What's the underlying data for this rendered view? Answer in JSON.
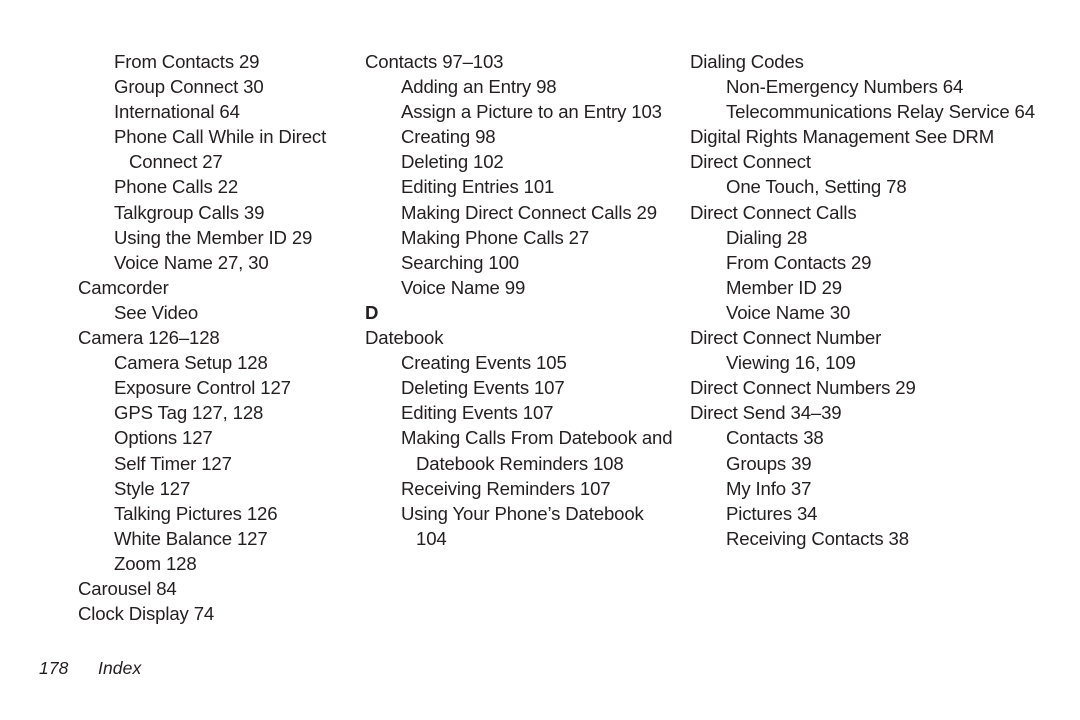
{
  "document": {
    "type": "index-page",
    "footer": {
      "page_number": "178",
      "label": "Index"
    }
  },
  "columns": [
    {
      "id": "column-1",
      "blocks": [
        {
          "kind": "entry",
          "level": 1,
          "text": "From Contacts 29"
        },
        {
          "kind": "entry",
          "level": 1,
          "text": "Group Connect 30"
        },
        {
          "kind": "entry",
          "level": 1,
          "text": "International 64"
        },
        {
          "kind": "entry",
          "level": 1,
          "text": "Phone Call While in Direct Connect 27"
        },
        {
          "kind": "entry",
          "level": 1,
          "text": "Phone Calls 22"
        },
        {
          "kind": "entry",
          "level": 1,
          "text": "Talkgroup Calls 39"
        },
        {
          "kind": "entry",
          "level": 1,
          "text": "Using the Member ID 29"
        },
        {
          "kind": "entry",
          "level": 1,
          "text": "Voice Name 27, 30"
        },
        {
          "kind": "entry",
          "level": 0,
          "text": "Camcorder"
        },
        {
          "kind": "entry",
          "level": 1,
          "text": "See Video"
        },
        {
          "kind": "entry",
          "level": 0,
          "text": "Camera 126–128"
        },
        {
          "kind": "entry",
          "level": 1,
          "text": "Camera Setup 128"
        },
        {
          "kind": "entry",
          "level": 1,
          "text": "Exposure Control 127"
        },
        {
          "kind": "entry",
          "level": 1,
          "text": "GPS Tag 127, 128"
        },
        {
          "kind": "entry",
          "level": 1,
          "text": "Options 127"
        },
        {
          "kind": "entry",
          "level": 1,
          "text": "Self Timer 127"
        },
        {
          "kind": "entry",
          "level": 1,
          "text": "Style 127"
        },
        {
          "kind": "entry",
          "level": 1,
          "text": "Talking Pictures 126"
        },
        {
          "kind": "entry",
          "level": 1,
          "text": "White Balance 127"
        },
        {
          "kind": "entry",
          "level": 1,
          "text": "Zoom 128"
        },
        {
          "kind": "entry",
          "level": 0,
          "text": "Carousel 84"
        },
        {
          "kind": "entry",
          "level": 0,
          "text": "Clock Display 74"
        }
      ]
    },
    {
      "id": "column-2",
      "blocks": [
        {
          "kind": "entry",
          "level": 0,
          "text": "Contacts 97–103"
        },
        {
          "kind": "entry",
          "level": 1,
          "text": "Adding an Entry 98"
        },
        {
          "kind": "entry",
          "level": 1,
          "text": "Assign a Picture to an Entry 103"
        },
        {
          "kind": "entry",
          "level": 1,
          "text": "Creating 98"
        },
        {
          "kind": "entry",
          "level": 1,
          "text": "Deleting 102"
        },
        {
          "kind": "entry",
          "level": 1,
          "text": "Editing Entries 101"
        },
        {
          "kind": "entry",
          "level": 1,
          "text": "Making Direct Connect Calls 29"
        },
        {
          "kind": "entry",
          "level": 1,
          "text": "Making Phone Calls 27"
        },
        {
          "kind": "entry",
          "level": 1,
          "text": "Searching 100"
        },
        {
          "kind": "entry",
          "level": 1,
          "text": "Voice Name 99"
        },
        {
          "kind": "letter",
          "text": "D"
        },
        {
          "kind": "entry",
          "level": 0,
          "text": "Datebook"
        },
        {
          "kind": "entry",
          "level": 1,
          "text": "Creating Events 105"
        },
        {
          "kind": "entry",
          "level": 1,
          "text": "Deleting Events 107"
        },
        {
          "kind": "entry",
          "level": 1,
          "text": "Editing Events 107"
        },
        {
          "kind": "entry",
          "level": 1,
          "text": "Making Calls From Datebook and Datebook Reminders 108"
        },
        {
          "kind": "entry",
          "level": 1,
          "text": "Receiving Reminders 107"
        },
        {
          "kind": "entry",
          "level": 1,
          "text": "Using Your Phone’s Datebook 104"
        }
      ]
    },
    {
      "id": "column-3",
      "blocks": [
        {
          "kind": "entry",
          "level": 0,
          "text": "Dialing Codes"
        },
        {
          "kind": "entry",
          "level": 1,
          "text": "Non-Emergency Numbers 64"
        },
        {
          "kind": "entry",
          "level": 1,
          "text": "Telecommunications Relay Service 64"
        },
        {
          "kind": "entry",
          "level": 0,
          "text": "Digital Rights Management See DRM"
        },
        {
          "kind": "entry",
          "level": 0,
          "text": "Direct Connect"
        },
        {
          "kind": "entry",
          "level": 1,
          "text": "One Touch, Setting 78"
        },
        {
          "kind": "entry",
          "level": 0,
          "text": "Direct Connect Calls"
        },
        {
          "kind": "entry",
          "level": 1,
          "text": "Dialing 28"
        },
        {
          "kind": "entry",
          "level": 1,
          "text": "From Contacts 29"
        },
        {
          "kind": "entry",
          "level": 1,
          "text": "Member ID 29"
        },
        {
          "kind": "entry",
          "level": 1,
          "text": "Voice Name 30"
        },
        {
          "kind": "entry",
          "level": 0,
          "text": "Direct Connect Number"
        },
        {
          "kind": "entry",
          "level": 1,
          "text": "Viewing 16, 109"
        },
        {
          "kind": "entry",
          "level": 0,
          "text": "Direct Connect Numbers 29"
        },
        {
          "kind": "entry",
          "level": 0,
          "text": "Direct Send 34–39"
        },
        {
          "kind": "entry",
          "level": 1,
          "text": "Contacts 38"
        },
        {
          "kind": "entry",
          "level": 1,
          "text": "Groups 39"
        },
        {
          "kind": "entry",
          "level": 1,
          "text": "My Info 37"
        },
        {
          "kind": "entry",
          "level": 1,
          "text": "Pictures 34"
        },
        {
          "kind": "entry",
          "level": 1,
          "text": "Receiving Contacts 38"
        }
      ]
    }
  ]
}
